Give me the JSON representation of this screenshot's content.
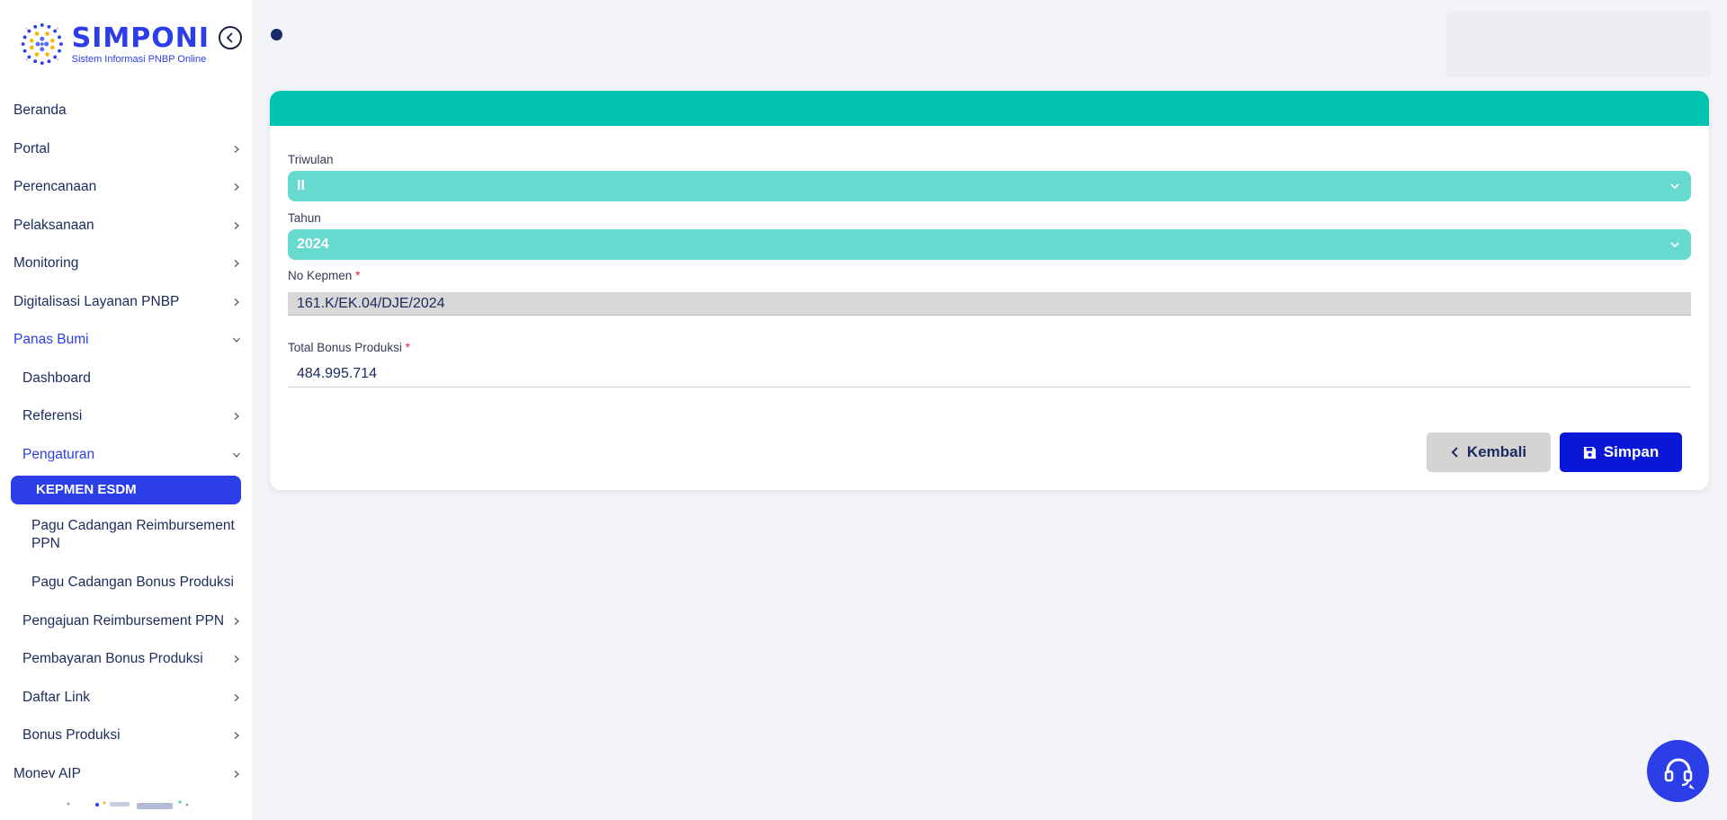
{
  "brand": {
    "title": "SIMPONI",
    "subtitle": "Sistem Informasi PNBP Online",
    "color": "#2b3ee8"
  },
  "sidebar": {
    "items": [
      {
        "label": "Beranda",
        "level": 0,
        "chevron": "none"
      },
      {
        "label": "Portal",
        "level": 0,
        "chevron": "right"
      },
      {
        "label": "Perencanaan",
        "level": 0,
        "chevron": "right"
      },
      {
        "label": "Pelaksanaan",
        "level": 0,
        "chevron": "right"
      },
      {
        "label": "Monitoring",
        "level": 0,
        "chevron": "right"
      },
      {
        "label": "Digitalisasi Layanan PNBP",
        "level": 0,
        "chevron": "right"
      },
      {
        "label": "Panas Bumi",
        "level": 0,
        "chevron": "down",
        "expanded": true
      },
      {
        "label": "Dashboard",
        "level": 1,
        "chevron": "none"
      },
      {
        "label": "Referensi",
        "level": 1,
        "chevron": "right"
      },
      {
        "label": "Pengaturan",
        "level": 1,
        "chevron": "down",
        "expanded": true
      },
      {
        "label": "KEPMEN ESDM",
        "level": 2,
        "selected": true
      },
      {
        "label": "Pagu Cadangan Reimbursement PPN",
        "level": 2,
        "chevron": "none"
      },
      {
        "label": "Pagu Cadangan Bonus Produksi",
        "level": 2,
        "chevron": "none"
      },
      {
        "label": "Pengajuan Reimbursement PPN",
        "level": 1,
        "chevron": "right"
      },
      {
        "label": "Pembayaran Bonus Produksi",
        "level": 1,
        "chevron": "right"
      },
      {
        "label": "Daftar Link",
        "level": 1,
        "chevron": "right"
      },
      {
        "label": "Bonus Produksi",
        "level": 1,
        "chevron": "right"
      },
      {
        "label": "Monev AIP",
        "level": 0,
        "chevron": "right"
      }
    ]
  },
  "form": {
    "header_color": "#00c4b0",
    "triwulan": {
      "label": "Triwulan",
      "value": "II"
    },
    "tahun": {
      "label": "Tahun",
      "value": "2024"
    },
    "no_kepmen": {
      "label": "No Kepmen",
      "required_mark": "*",
      "value": "161.K/EK.04/DJE/2024"
    },
    "total_bonus": {
      "label": "Total Bonus Produksi",
      "required_mark": "*",
      "value": "484.995.714"
    }
  },
  "actions": {
    "back_label": "Kembali",
    "save_label": "Simpan"
  },
  "icons": {
    "collapse": "chevron-left-circle-icon",
    "save": "floppy-disk-icon",
    "back": "chevron-left-icon",
    "help": "headset-icon"
  }
}
